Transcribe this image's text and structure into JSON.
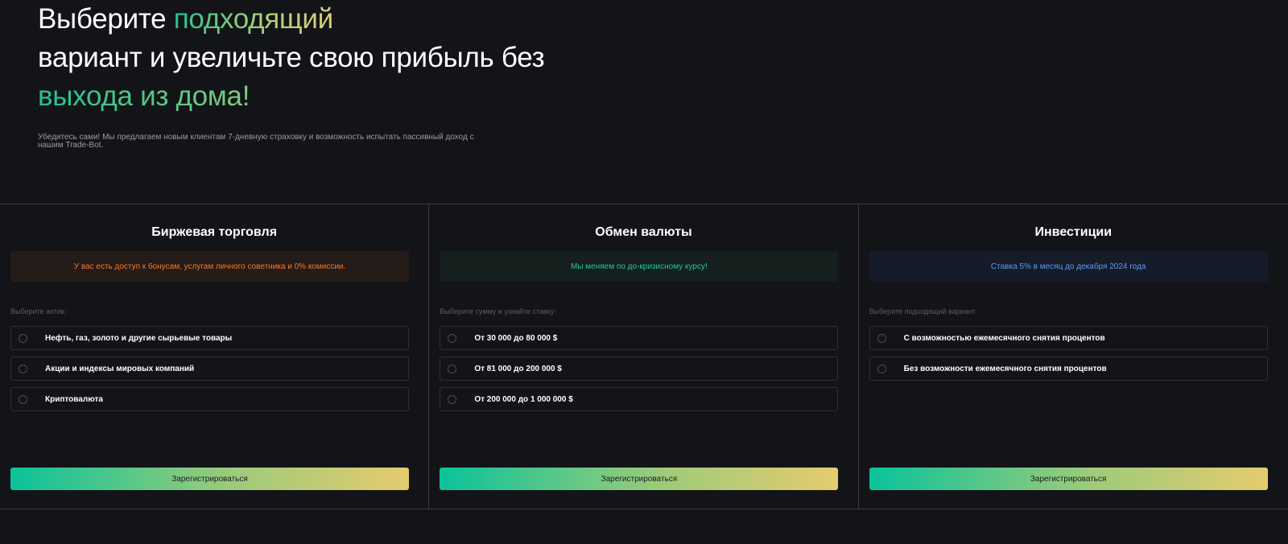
{
  "hero": {
    "title_part1": "Выберите ",
    "title_highlight1": "подходящий",
    "title_line2": "вариант и увеличьте свою прибыль без",
    "title_highlight2": "выхода из дома!",
    "subtitle": "Убедитесь сами! Мы предлагаем новым клиентам 7-дневную страховку и возможность испытать пассивный доход с нашим Trade-Bot."
  },
  "colors": {
    "background": "#131418",
    "accent_start": "#0ac39a",
    "accent_end": "#e6cb6e",
    "notice_orange": "#f07b2e",
    "notice_green": "#2cc59a",
    "notice_blue": "#5b9bf0"
  },
  "plans": [
    {
      "title": "Биржевая торговля",
      "notice": "У вас есть доступ к бонусам, услугам личного советника и 0% комиссии.",
      "field_label": "Выберите актив:",
      "options": [
        "Нефть, газ, золото и другие сырьевые товары",
        "Акции и индексы мировых компаний",
        "Криптовалюта"
      ],
      "button": "Зарегистрироваться"
    },
    {
      "title": "Обмен валюты",
      "notice": "Мы меняем по до-кризисному курсу!",
      "field_label": "Выберите сумму и узнайте ставку:",
      "options": [
        "От 30 000 до 80 000 $",
        "От 81 000 до 200 000 $",
        "От 200 000 до 1 000 000 $"
      ],
      "button": "Зарегистрироваться"
    },
    {
      "title": "Инвестиции",
      "notice": "Ставка 5% в месяц до декабря 2024 года",
      "field_label": "Выберите подходящий вариант:",
      "options": [
        "С возможностью ежемесячного снятия процентов",
        "Без возможности ежемесячного снятия процентов"
      ],
      "button": "Зарегистрироваться"
    }
  ]
}
